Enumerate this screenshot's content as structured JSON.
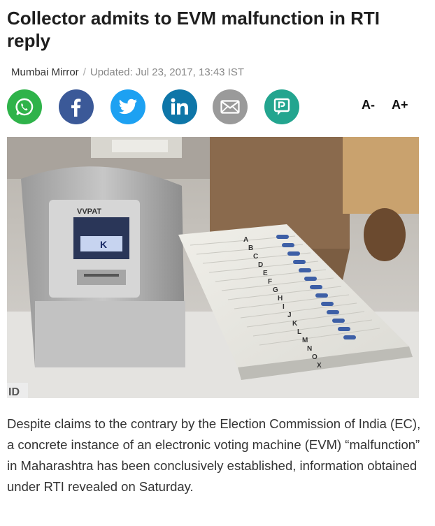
{
  "article": {
    "headline": "Collector admits to EVM malfunction in RTI reply",
    "source": "Mumbai Mirror",
    "separator": "/",
    "updated": "Updated: Jul 23, 2017, 13:43 IST",
    "body": "Despite claims to the contrary by the Election Commission of India (EC), a concrete instance of an electronic voting machine (EVM) “malfunction” in Maharashtra has been conclusively established, information obtained under RTI revealed on Saturday."
  },
  "share": {
    "buttons": [
      {
        "name": "whatsapp",
        "icon": "whatsapp-icon",
        "color": "#2fb34a"
      },
      {
        "name": "facebook",
        "icon": "facebook-icon",
        "color": "#3b5998"
      },
      {
        "name": "twitter",
        "icon": "twitter-icon",
        "color": "#1da1f2"
      },
      {
        "name": "linkedin",
        "icon": "linkedin-icon",
        "color": "#0e76a8"
      },
      {
        "name": "email",
        "icon": "mail-icon",
        "color": "#9a9a9a"
      },
      {
        "name": "comment",
        "icon": "comment-icon",
        "color": "#23a58f"
      }
    ],
    "font_decrease": "A-",
    "font_increase": "A+"
  },
  "photo": {
    "vvpat_label": "VVPAT",
    "screen_letter": "K",
    "corner_text": "ID",
    "ballot_letters": [
      "A",
      "B",
      "C",
      "D",
      "E",
      "F",
      "G",
      "H",
      "I",
      "J",
      "K",
      "L",
      "M",
      "N",
      "O",
      "X"
    ]
  }
}
